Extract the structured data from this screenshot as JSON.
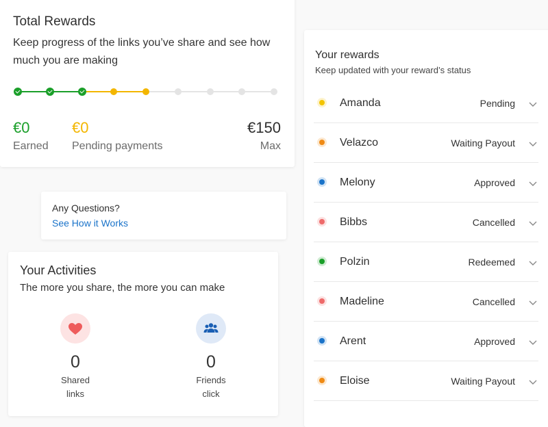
{
  "total_rewards": {
    "title": "Total Rewards",
    "subtitle": "Keep progress of the links you’ve share and see how much you are making",
    "progress": {
      "completed_steps": 3,
      "pending_steps": 2,
      "total_steps": 9
    },
    "earned": {
      "value": "€0",
      "label": "Earned"
    },
    "pending": {
      "value": "€0",
      "label": "Pending payments"
    },
    "max": {
      "value": "€150",
      "label": "Max"
    }
  },
  "questions": {
    "text": "Any Questions?",
    "link": "See How it Works"
  },
  "activities": {
    "title": "Your Activities",
    "subtitle": "The more you share, the more you can make",
    "items": [
      {
        "icon": "heart-icon",
        "count": "0",
        "label_1": "Shared",
        "label_2": "links"
      },
      {
        "icon": "friends-icon",
        "count": "0",
        "label_1": "Friends",
        "label_2": "click"
      }
    ]
  },
  "rewards": {
    "title": "Your rewards",
    "subtitle": "Keep updated with your reward’s status",
    "items": [
      {
        "name": "Amanda",
        "status": "Pending",
        "color": "#f3c400"
      },
      {
        "name": "Velazco",
        "status": "Waiting Payout",
        "color": "#ef8a14"
      },
      {
        "name": "Melony",
        "status": "Approved",
        "color": "#1a73c9"
      },
      {
        "name": "Bibbs",
        "status": "Cancelled",
        "color": "#ee6a6a"
      },
      {
        "name": "Polzin",
        "status": "Redeemed",
        "color": "#1a9f29"
      },
      {
        "name": "Madeline",
        "status": "Cancelled",
        "color": "#ee6a6a"
      },
      {
        "name": "Arent",
        "status": "Approved",
        "color": "#1a73c9"
      },
      {
        "name": "Eloise",
        "status": "Waiting Payout",
        "color": "#ef8a14"
      }
    ]
  },
  "colors": {
    "earned": "#1a9f29",
    "pending": "#f3b600",
    "link": "#1a73c9"
  }
}
